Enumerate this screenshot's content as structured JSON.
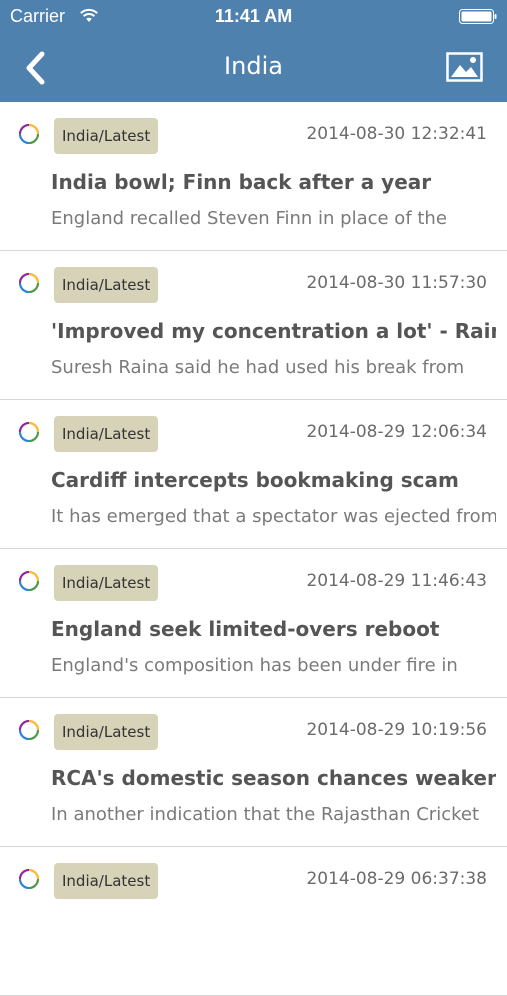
{
  "status_bar": {
    "carrier": "Carrier",
    "time": "11:41 AM",
    "wifi_icon": "wifi-icon",
    "battery_icon": "battery-icon"
  },
  "nav": {
    "title": "India",
    "back_icon": "chevron-left-icon",
    "image_icon": "image-icon"
  },
  "colors": {
    "header": "#4f81ae",
    "tag_background": "#d6d3b8",
    "headline": "#555555",
    "summary": "#7a7a7a"
  },
  "articles": [
    {
      "tag": "India/Latest",
      "timestamp": "2014-08-30 12:32:41",
      "headline": "India bowl; Finn back after a year",
      "summary": "England recalled Steven Finn in place of the"
    },
    {
      "tag": "India/Latest",
      "timestamp": "2014-08-30 11:57:30",
      "headline": "'Improved my concentration a lot' - Raina",
      "summary": "Suresh Raina said he had used his break from"
    },
    {
      "tag": "India/Latest",
      "timestamp": "2014-08-29 12:06:34",
      "headline": "Cardiff intercepts bookmaking scam",
      "summary": "It has emerged that a spectator was ejected from"
    },
    {
      "tag": "India/Latest",
      "timestamp": "2014-08-29 11:46:43",
      "headline": "England seek limited-overs reboot",
      "summary": "England's composition has been under fire in"
    },
    {
      "tag": "India/Latest",
      "timestamp": "2014-08-29 10:19:56",
      "headline": "RCA's domestic season chances weaken",
      "summary": "In another indication that the Rajasthan Cricket"
    },
    {
      "tag": "India/Latest",
      "timestamp": "2014-08-29 06:37:38",
      "headline": "",
      "summary": ""
    }
  ]
}
